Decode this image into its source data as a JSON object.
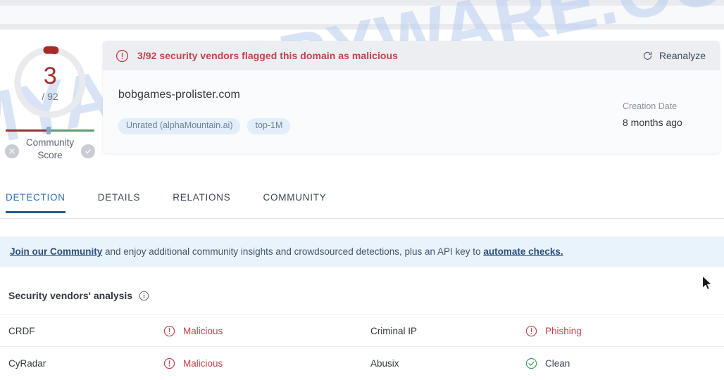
{
  "score": {
    "value": "3",
    "total": "/ 92",
    "arc_color": "#a62a2a",
    "ring_color": "#e9eaee",
    "community_label": "Community\nScore",
    "community_label_line1": "Community",
    "community_label_line2": "Score",
    "bad_icon": "x-circle-icon",
    "good_icon": "check-circle-icon"
  },
  "alert": {
    "icon": "exclamation-circle-icon",
    "text": "3/92 security vendors flagged this domain as malicious",
    "color": "#c0434a",
    "background": "#eceef2"
  },
  "reanalyze": {
    "icon": "refresh-icon",
    "label": "Reanalyze"
  },
  "domain": {
    "name": "bobgames-prolister.com",
    "tags": [
      {
        "label": "Unrated (alphaMountain.ai)"
      },
      {
        "label": "top-1M"
      }
    ]
  },
  "creation": {
    "label": "Creation Date",
    "value": "8 months ago"
  },
  "tabs": [
    {
      "label": "DETECTION",
      "active": true
    },
    {
      "label": "DETAILS",
      "active": false
    },
    {
      "label": "RELATIONS",
      "active": false
    },
    {
      "label": "COMMUNITY",
      "active": false
    }
  ],
  "community_banner": {
    "link1": "Join our Community",
    "middle": " and enjoy additional community insights and crowdsourced detections, plus an API key to ",
    "link2": "automate checks.",
    "background": "#e9f3fc"
  },
  "vendors_section": {
    "title": "Security vendors' analysis",
    "info_icon": "info-circle-icon"
  },
  "vendor_rows": [
    {
      "left_name": "CRDF",
      "left_verdict": "Malicious",
      "left_icon": "exclamation-circle-icon",
      "left_state": "malicious",
      "right_name": "Criminal IP",
      "right_verdict": "Phishing",
      "right_icon": "exclamation-circle-icon",
      "right_state": "phishing"
    },
    {
      "left_name": "CyRadar",
      "left_verdict": "Malicious",
      "left_icon": "exclamation-circle-icon",
      "left_state": "malicious",
      "right_name": "Abusix",
      "right_verdict": "Clean",
      "right_icon": "check-circle-icon",
      "right_state": "clean"
    }
  ],
  "watermark": {
    "text": "MYANTISPYWARE.COM",
    "color": "#b9cdf0"
  }
}
